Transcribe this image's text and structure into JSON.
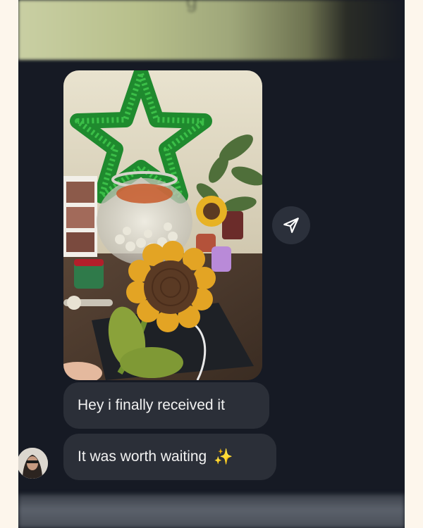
{
  "chat": {
    "messages": [
      {
        "sender": "other",
        "text": "Hey i finally received it"
      },
      {
        "sender": "other",
        "text": "It was worth waiting",
        "emoji": "✨"
      }
    ]
  },
  "icons": {
    "share": "paper-plane-icon",
    "sparkles": "sparkles-icon"
  },
  "colors": {
    "chat_background": "#161a24",
    "bubble_background": "#2b2f38",
    "bubble_text": "#f2f2f2",
    "page_background": "#fdf6ec"
  }
}
